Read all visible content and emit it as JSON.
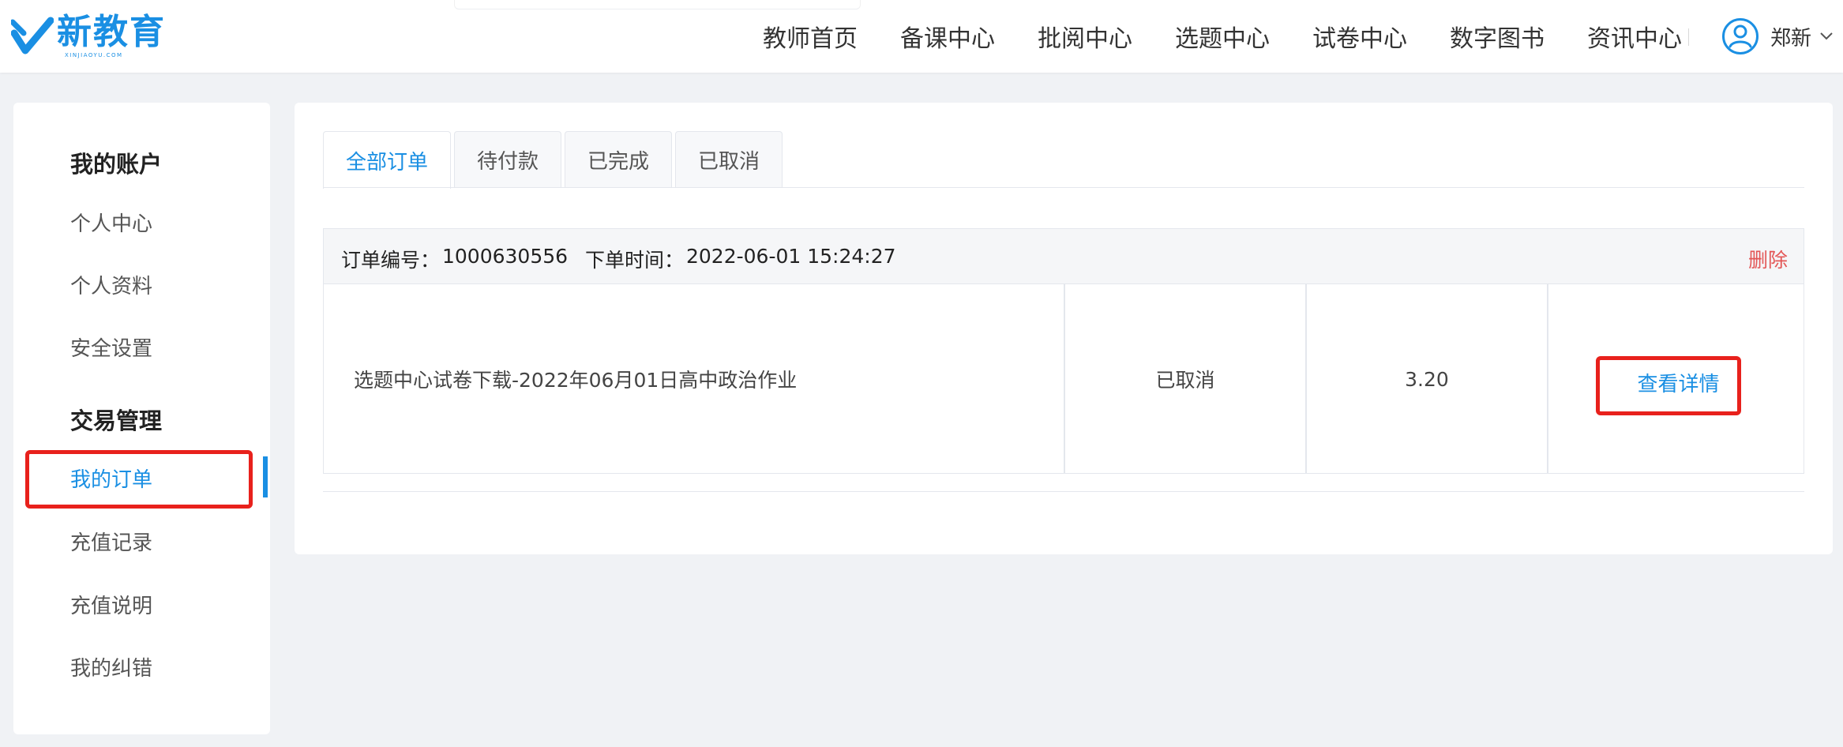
{
  "header": {
    "logo_text": "新教育",
    "logo_sub": "XINJIAOYU.COM",
    "nav": [
      "教师首页",
      "备课中心",
      "批阅中心",
      "选题中心",
      "试卷中心",
      "数字图书",
      "资讯中心"
    ],
    "user_name": "郑新"
  },
  "sidebar": {
    "account_heading": "我的账户",
    "account_items": [
      "个人中心",
      "个人资料",
      "安全设置"
    ],
    "trade_heading": "交易管理",
    "trade_items": [
      "我的订单",
      "充值记录",
      "充值说明",
      "我的纠错"
    ]
  },
  "main": {
    "tabs": [
      "全部订单",
      "待付款",
      "已完成",
      "已取消"
    ],
    "order": {
      "number_label": "订单编号：",
      "number": "1000630556",
      "time_label": "下单时间：",
      "time": "2022-06-01 15:24:27",
      "delete_label": "删除",
      "title": "选题中心试卷下载-2022年06月01日高中政治作业",
      "status": "已取消",
      "amount": "3.20",
      "detail_label": "查看详情"
    }
  },
  "colors": {
    "accent": "#1a8fe3",
    "highlight": "#e8211c",
    "delete": "#e35656"
  }
}
